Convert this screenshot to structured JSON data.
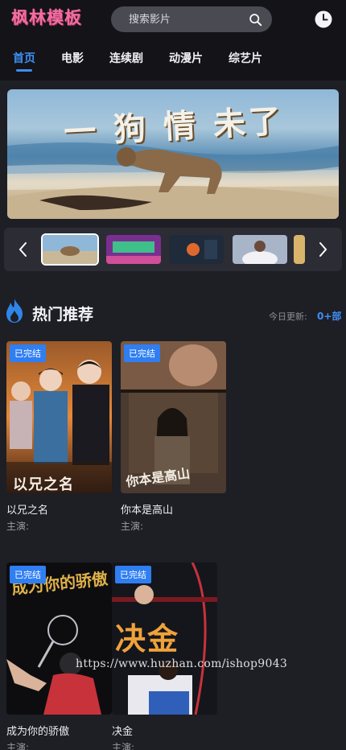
{
  "header": {
    "logo": "枫林模板",
    "search_placeholder": "搜索影片",
    "icons": {
      "search": "search-icon",
      "history": "clock-icon"
    },
    "accent_color": "#3f8ef5",
    "logo_color": "#f06fa1"
  },
  "nav": {
    "tabs": [
      {
        "label": "首页",
        "active": true
      },
      {
        "label": "电影",
        "active": false
      },
      {
        "label": "连续剧",
        "active": false
      },
      {
        "label": "动漫片",
        "active": false
      },
      {
        "label": "综艺片",
        "active": false
      }
    ]
  },
  "banner": {
    "title": "一 狗 情 未了",
    "thumbnails": [
      "banner-thumb-1",
      "banner-thumb-2",
      "banner-thumb-3",
      "banner-thumb-4",
      "banner-thumb-5"
    ],
    "prev_icon": "chevron-left-icon",
    "next_icon": "chevron-right-icon"
  },
  "hot": {
    "title": "热门推荐",
    "icon": "flame-icon",
    "update_label": "今日更新:",
    "update_count": "0+部",
    "items": [
      {
        "title": "以兄之名",
        "cast": "主演:",
        "badge": "已完结",
        "poster_text": "以兄之名"
      },
      {
        "title": "你本是高山",
        "cast": "主演:",
        "badge": "已完结",
        "poster_text": "你本是高山"
      },
      {
        "title": "成为你的骄傲",
        "cast": "主演:",
        "badge": "已完结",
        "poster_text": "成为你的骄傲"
      },
      {
        "title": "决金",
        "cast": "主演:",
        "badge": "已完结",
        "poster_text": "决金"
      }
    ]
  },
  "watermark": "https://www.huzhan.com/ishop9043"
}
